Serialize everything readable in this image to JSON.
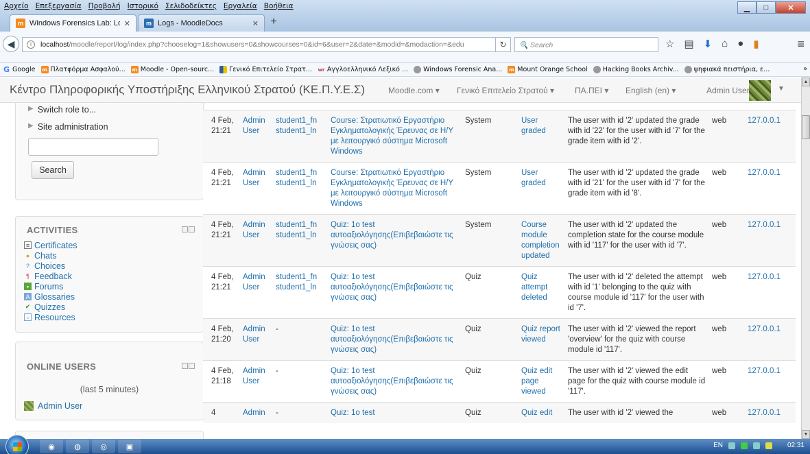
{
  "browser": {
    "menu": [
      "Αρχείο",
      "Επεξεργασία",
      "Προβολή",
      "Ιστορικό",
      "Σελιδοδείκτες",
      "Εργαλεία",
      "Βοήθεια"
    ],
    "tabs": [
      {
        "title": "Windows Forensics Lab: Lo...",
        "favicon": "moodle-icon",
        "active": true
      },
      {
        "title": "Logs - MoodleDocs",
        "favicon": "moodle-docs-icon",
        "active": false
      }
    ],
    "url_host": "localhost",
    "url_path": "/moodle/report/log/index.php?chooselog=1&showusers=0&showcourses=0&id=6&user=2&date=&modid=&modaction=&edu",
    "search_placeholder": "Search",
    "bookmarks": [
      "Google",
      "Πλατφόρμα Ασφαλού...",
      "Moodle - Open-sourc...",
      "Γενικό Επιτελείο Στρατ...",
      "Αγγλοελληνικό Λεξικό ...",
      "Windows Forensic Ana...",
      "Mount Orange School",
      "Hacking Books Archiv...",
      "ψηφιακά πειστήρια, ε..."
    ],
    "bookmarks_more": "»"
  },
  "header": {
    "site_title": "Κέντρο Πληροφορικής Υποστήριξης Ελληνικού Στρατού (ΚΕ.Π.Υ.Ε.Σ)",
    "menus": [
      "Moodle.com ▾",
      "Γενικό Επιτελείο Στρατού ▾",
      "ΠΑ.ΠΕΙ ▾",
      "English (en) ▾"
    ],
    "user": "Admin User"
  },
  "sidebar": {
    "nav": [
      "Switch role to...",
      "Site administration"
    ],
    "search_button": "Search",
    "activities_title": "ACTIVITIES",
    "activities": [
      {
        "label": "Certificates",
        "icon": "certificate-icon"
      },
      {
        "label": "Chats",
        "icon": "chat-icon"
      },
      {
        "label": "Choices",
        "icon": "choice-icon"
      },
      {
        "label": "Feedback",
        "icon": "feedback-icon"
      },
      {
        "label": "Forums",
        "icon": "forum-icon"
      },
      {
        "label": "Glossaries",
        "icon": "glossary-icon"
      },
      {
        "label": "Quizzes",
        "icon": "quiz-icon"
      },
      {
        "label": "Resources",
        "icon": "resource-icon"
      }
    ],
    "online_title": "ONLINE USERS",
    "online_sub": "(last 5 minutes)",
    "online_user": "Admin User"
  },
  "log": {
    "rows": [
      {
        "time": "4 Feb, 21:21",
        "user": "Admin User",
        "affected": "student1_fn student1_ln",
        "context": "Course: Στρατιωτικό Εργαστήριο Εγκληματολογικής Έρευνας σε Η/Υ με λειτουργικό σύστημα Microsoft Windows",
        "component": "System",
        "event": "User graded",
        "description": "The user with id '2' updated the grade with id '22' for the user with id '7' for the grade item with id '2'.",
        "origin": "web",
        "ip": "127.0.0.1"
      },
      {
        "time": "4 Feb, 21:21",
        "user": "Admin User",
        "affected": "student1_fn student1_ln",
        "context": "Course: Στρατιωτικό Εργαστήριο Εγκληματολογικής Έρευνας σε Η/Υ με λειτουργικό σύστημα Microsoft Windows",
        "component": "System",
        "event": "User graded",
        "description": "The user with id '2' updated the grade with id '21' for the user with id '7' for the grade item with id '8'.",
        "origin": "web",
        "ip": "127.0.0.1"
      },
      {
        "time": "4 Feb, 21:21",
        "user": "Admin User",
        "affected": "student1_fn student1_ln",
        "context": "Quiz: 1ο test αυτοαξιολόγησης(Επιβεβαιώστε τις γνώσεις σας)",
        "component": "System",
        "event": "Course module completion updated",
        "description": "The user with id '2' updated the completion state for the course module with id '117' for the user with id '7'.",
        "origin": "web",
        "ip": "127.0.0.1"
      },
      {
        "time": "4 Feb, 21:21",
        "user": "Admin User",
        "affected": "student1_fn student1_ln",
        "context": "Quiz: 1ο test αυτοαξιολόγησης(Επιβεβαιώστε τις γνώσεις σας)",
        "component": "Quiz",
        "event": "Quiz attempt deleted",
        "description": "The user with id '2' deleted the attempt with id '1' belonging to the quiz with course module id '117' for the user with id '7'.",
        "origin": "web",
        "ip": "127.0.0.1"
      },
      {
        "time": "4 Feb, 21:20",
        "user": "Admin User",
        "affected": "-",
        "context": "Quiz: 1ο test αυτοαξιολόγησης(Επιβεβαιώστε τις γνώσεις σας)",
        "component": "Quiz",
        "event": "Quiz report viewed",
        "description": "The user with id '2' viewed the report 'overview' for the quiz with course module id '117'.",
        "origin": "web",
        "ip": "127.0.0.1"
      },
      {
        "time": "4 Feb, 21:18",
        "user": "Admin User",
        "affected": "-",
        "context": "Quiz: 1ο test αυτοαξιολόγησης(Επιβεβαιώστε τις γνώσεις σας)",
        "component": "Quiz",
        "event": "Quiz edit page viewed",
        "description": "The user with id '2' viewed the edit page for the quiz with course module id '117'.",
        "origin": "web",
        "ip": "127.0.0.1"
      },
      {
        "time": "4",
        "user": "Admin",
        "affected": "-",
        "context": "Quiz: 1ο test",
        "component": "Quiz",
        "event": "Quiz edit",
        "description": "The user with id '2' viewed the",
        "origin": "web",
        "ip": "127.0.0.1"
      }
    ]
  },
  "taskbar": {
    "lang": "EN",
    "clock": "02:31"
  }
}
